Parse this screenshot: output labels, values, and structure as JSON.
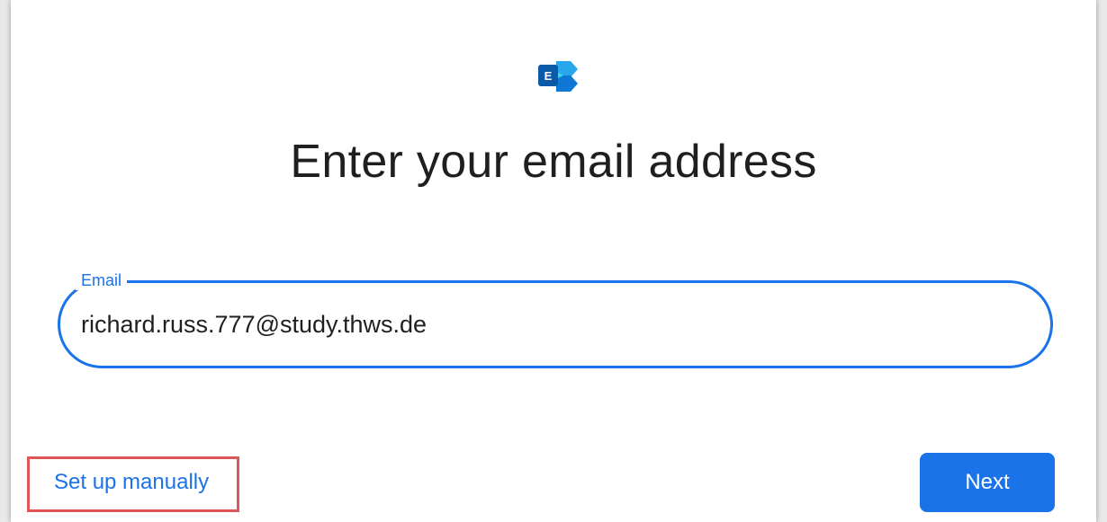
{
  "app": {
    "logo_icon": "exchange-logo-icon",
    "logo_letter": "E"
  },
  "page": {
    "title": "Enter your email address"
  },
  "email_field": {
    "label": "Email",
    "value": "richard.russ.777@study.thws.de"
  },
  "actions": {
    "manual_setup_label": "Set up manually",
    "next_label": "Next"
  },
  "colors": {
    "accent": "#1a73e8",
    "text": "#1f1f1f",
    "highlight": "#e05656",
    "logo_dark": "#0b5aa8",
    "logo_light": "#28a8ea"
  }
}
